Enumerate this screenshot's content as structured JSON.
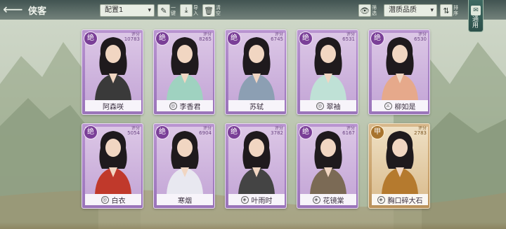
{
  "header": {
    "back_icon": "back-arrow-icon",
    "title": "侠客",
    "preset_select": "配置1",
    "paint_label": "一键",
    "import_label": "导入",
    "clear_label": "清空",
    "filter_label": "筛选",
    "quality_select": "潜质品质",
    "sort_label": "排序",
    "equip_tab_label": "通用"
  },
  "cards": [
    {
      "name": "阿森咲",
      "rank": "绝",
      "score_label": "评分",
      "score": "10783",
      "school_icon": "",
      "frame": "purple"
    },
    {
      "name": "李香君",
      "rank": "绝",
      "score_label": "评分",
      "score": "8265",
      "school_icon": "swirl-school-icon",
      "frame": "purple"
    },
    {
      "name": "苏轼",
      "rank": "绝",
      "score_label": "评分",
      "score": "6745",
      "school_icon": "",
      "frame": "purple"
    },
    {
      "name": "翠袖",
      "rank": "绝",
      "score_label": "评分",
      "score": "6531",
      "school_icon": "swirl-school-icon",
      "frame": "purple"
    },
    {
      "name": "柳如是",
      "rank": "绝",
      "score_label": "评分",
      "score": "6530",
      "school_icon": "sword-school-icon",
      "frame": "purple"
    },
    {
      "name": "白衣",
      "rank": "绝",
      "score_label": "评分",
      "score": "5054",
      "school_icon": "swirl-school-icon",
      "frame": "purple"
    },
    {
      "name": "寒烟",
      "rank": "绝",
      "score_label": "评分",
      "score": "6904",
      "school_icon": "",
      "frame": "purple"
    },
    {
      "name": "叶雨时",
      "rank": "绝",
      "score_label": "评分",
      "score": "3782",
      "school_icon": "shield-school-icon",
      "frame": "purple"
    },
    {
      "name": "花镜棠",
      "rank": "绝",
      "score_label": "评分",
      "score": "6167",
      "school_icon": "shield-school-icon",
      "frame": "purple"
    },
    {
      "name": "胸口碎大石",
      "rank": "甲",
      "score_label": "评分",
      "score": "2783",
      "school_icon": "shield-school-icon",
      "frame": "gold"
    }
  ]
}
